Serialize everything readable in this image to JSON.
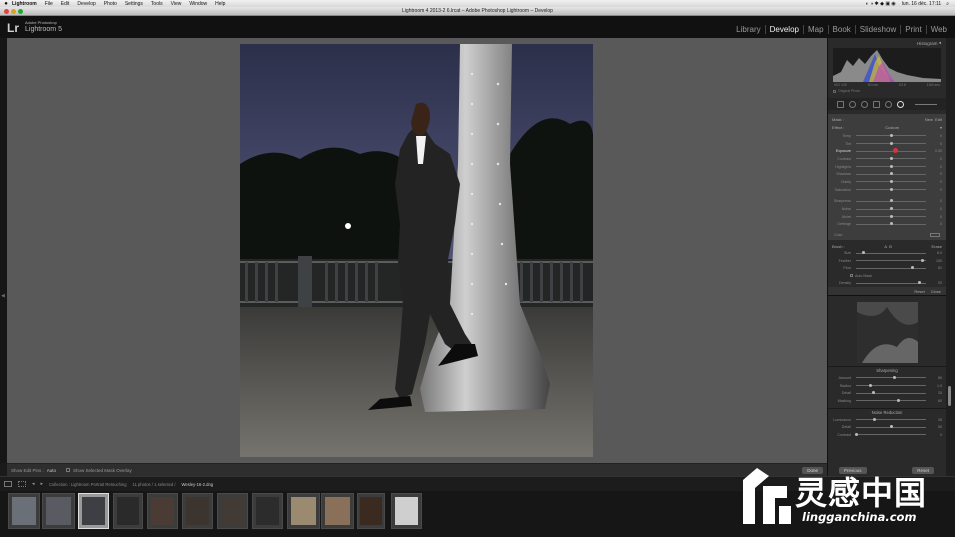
{
  "menubar": {
    "items": [
      "Lightroom",
      "File",
      "Edit",
      "Develop",
      "Photo",
      "Settings",
      "Tools",
      "View",
      "Window",
      "Help"
    ],
    "clock": "lun. 16 déc.  17:11"
  },
  "window": {
    "title": "Lightroom 4 2013-2 6.lrcat – Adobe Photoshop Lightroom – Develop"
  },
  "identity": {
    "lr": "Lr",
    "line1": "Adobe Photoshop",
    "line2": "Lightroom 5"
  },
  "modules": [
    {
      "label": "Library",
      "active": false
    },
    {
      "label": "Develop",
      "active": true
    },
    {
      "label": "Map",
      "active": false
    },
    {
      "label": "Book",
      "active": false
    },
    {
      "label": "Slideshow",
      "active": false
    },
    {
      "label": "Print",
      "active": false
    },
    {
      "label": "Web",
      "active": false
    }
  ],
  "toolbar": {
    "show_edit_pins_label": "Show Edit Pins :",
    "show_edit_pins_value": "Auto",
    "overlay_label": "Show Selected Mask Overlay",
    "done": "Done"
  },
  "panel": {
    "histogram_title": "Histogram",
    "hist_labels": [
      "ISO 100",
      "50 mm",
      "f/2.8",
      "1/60 sec"
    ],
    "original_photo": "Original Photo",
    "mask_label": "Mask :",
    "mask_new": "New",
    "mask_edit": "Edit",
    "effect_label": "Effect :",
    "effect_value": "Custom",
    "sliders": [
      {
        "label": "Temp",
        "val": "0",
        "pos": 0.5
      },
      {
        "label": "Tint",
        "val": "0",
        "pos": 0.5
      },
      {
        "label": "Exposure",
        "val": "0.30",
        "pos": 0.55,
        "hi": true
      },
      {
        "label": "Contrast",
        "val": "0",
        "pos": 0.5
      },
      {
        "label": "Highlights",
        "val": "0",
        "pos": 0.5
      },
      {
        "label": "Shadows",
        "val": "0",
        "pos": 0.5
      },
      {
        "label": "Clarity",
        "val": "0",
        "pos": 0.5
      },
      {
        "label": "Saturation",
        "val": "0",
        "pos": 0.5
      },
      {
        "label": "Sharpness",
        "val": "0",
        "pos": 0.5,
        "gap": true
      },
      {
        "label": "Noise",
        "val": "0",
        "pos": 0.5
      },
      {
        "label": "Moiré",
        "val": "0",
        "pos": 0.5
      },
      {
        "label": "Defringe",
        "val": "0",
        "pos": 0.5
      }
    ],
    "color_label": "Color",
    "brush_label": "Brush :",
    "brush_a": "A",
    "brush_b": "B",
    "brush_erase": "Erase",
    "brush_sliders": [
      {
        "label": "Size",
        "val": "6.0",
        "pos": 0.1
      },
      {
        "label": "Feather",
        "val": "100",
        "pos": 0.95
      },
      {
        "label": "Flow",
        "val": "81",
        "pos": 0.8
      }
    ],
    "automask": "Auto Mask",
    "density": {
      "label": "Density",
      "val": "93",
      "pos": 0.9
    },
    "reset": "Reset",
    "close": "Close",
    "sharpening_title": "Sharpening",
    "sharpening": [
      {
        "label": "Amount",
        "val": "80",
        "pos": 0.55
      },
      {
        "label": "Radius",
        "val": "1.0",
        "pos": 0.2
      },
      {
        "label": "Detail",
        "val": "25",
        "pos": 0.25
      },
      {
        "label": "Masking",
        "val": "60",
        "pos": 0.6
      }
    ],
    "noise_title": "Noise Reduction",
    "noise": [
      {
        "label": "Luminance",
        "val": "26",
        "pos": 0.26
      },
      {
        "label": "Detail",
        "val": "50",
        "pos": 0.5
      },
      {
        "label": "Contrast",
        "val": "0",
        "pos": 0.0
      }
    ],
    "previous": "Previous",
    "reset_btn": "Reset"
  },
  "filmstrip": {
    "source": "Collection : Lightroom Portrait Retouching",
    "count": "11 photos / 1 selected /",
    "filename": "Wesley-16-2.dng"
  },
  "watermark": {
    "big": "灵感中国",
    "url": "lingganchina.com"
  }
}
